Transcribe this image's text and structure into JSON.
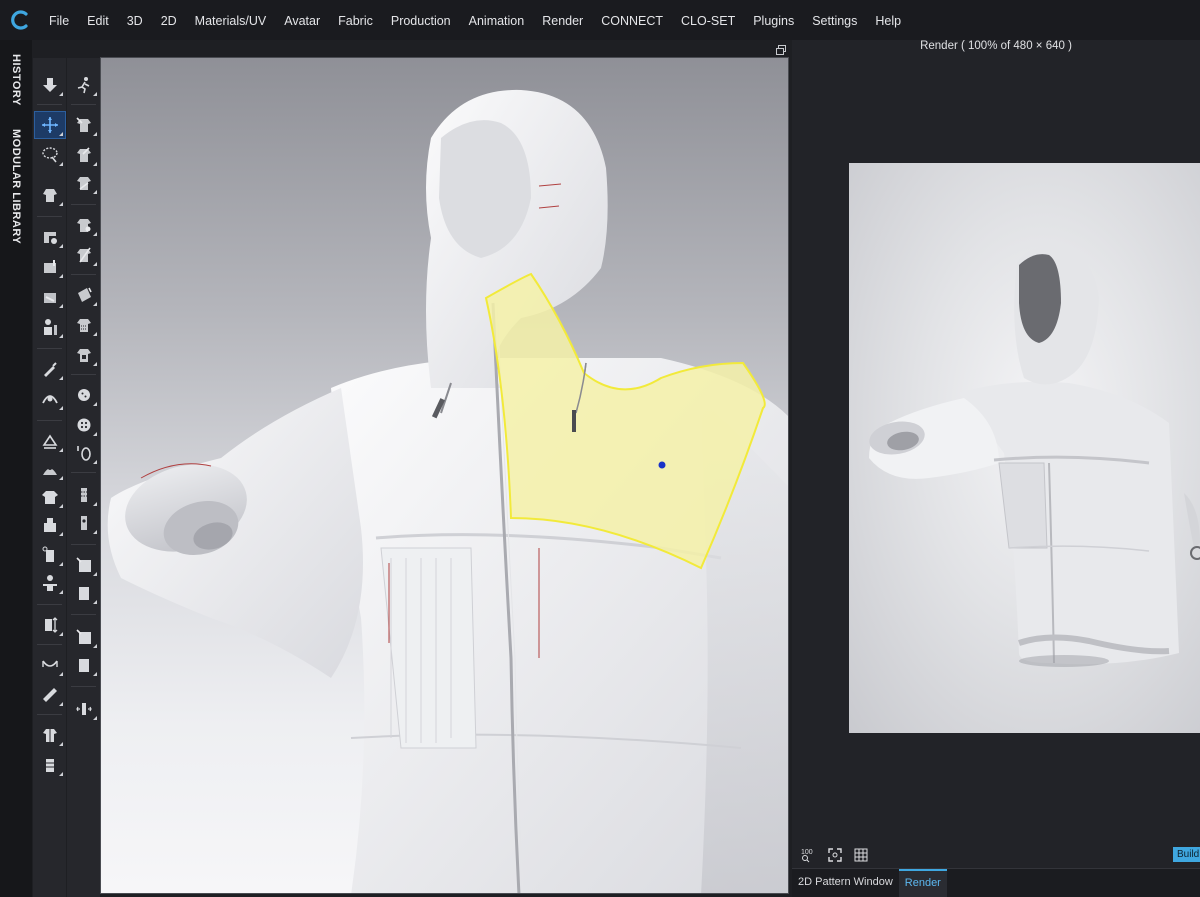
{
  "app": {
    "logo_icon": "clo-logo-icon",
    "accent": "#3fa7e0"
  },
  "menu": [
    "File",
    "Edit",
    "3D",
    "2D",
    "Materials/UV",
    "Avatar",
    "Fabric",
    "Production",
    "Animation",
    "Render",
    "CONNECT",
    "CLO-SET",
    "Plugins",
    "Settings",
    "Help"
  ],
  "side_tabs": {
    "history": "HISTORY",
    "modular_library": "MODULAR LIBRARY"
  },
  "render_panel": {
    "title": "Render ( 100% of 480 × 640 )",
    "zoom_label": "100",
    "build_label": "Build"
  },
  "bottom_tabs": {
    "pattern": "2D Pattern Window",
    "render": "Render",
    "active": "Render"
  },
  "viewport": {
    "selection_color": "#f5f1a8",
    "selection_outline": "#f2ea3a"
  }
}
